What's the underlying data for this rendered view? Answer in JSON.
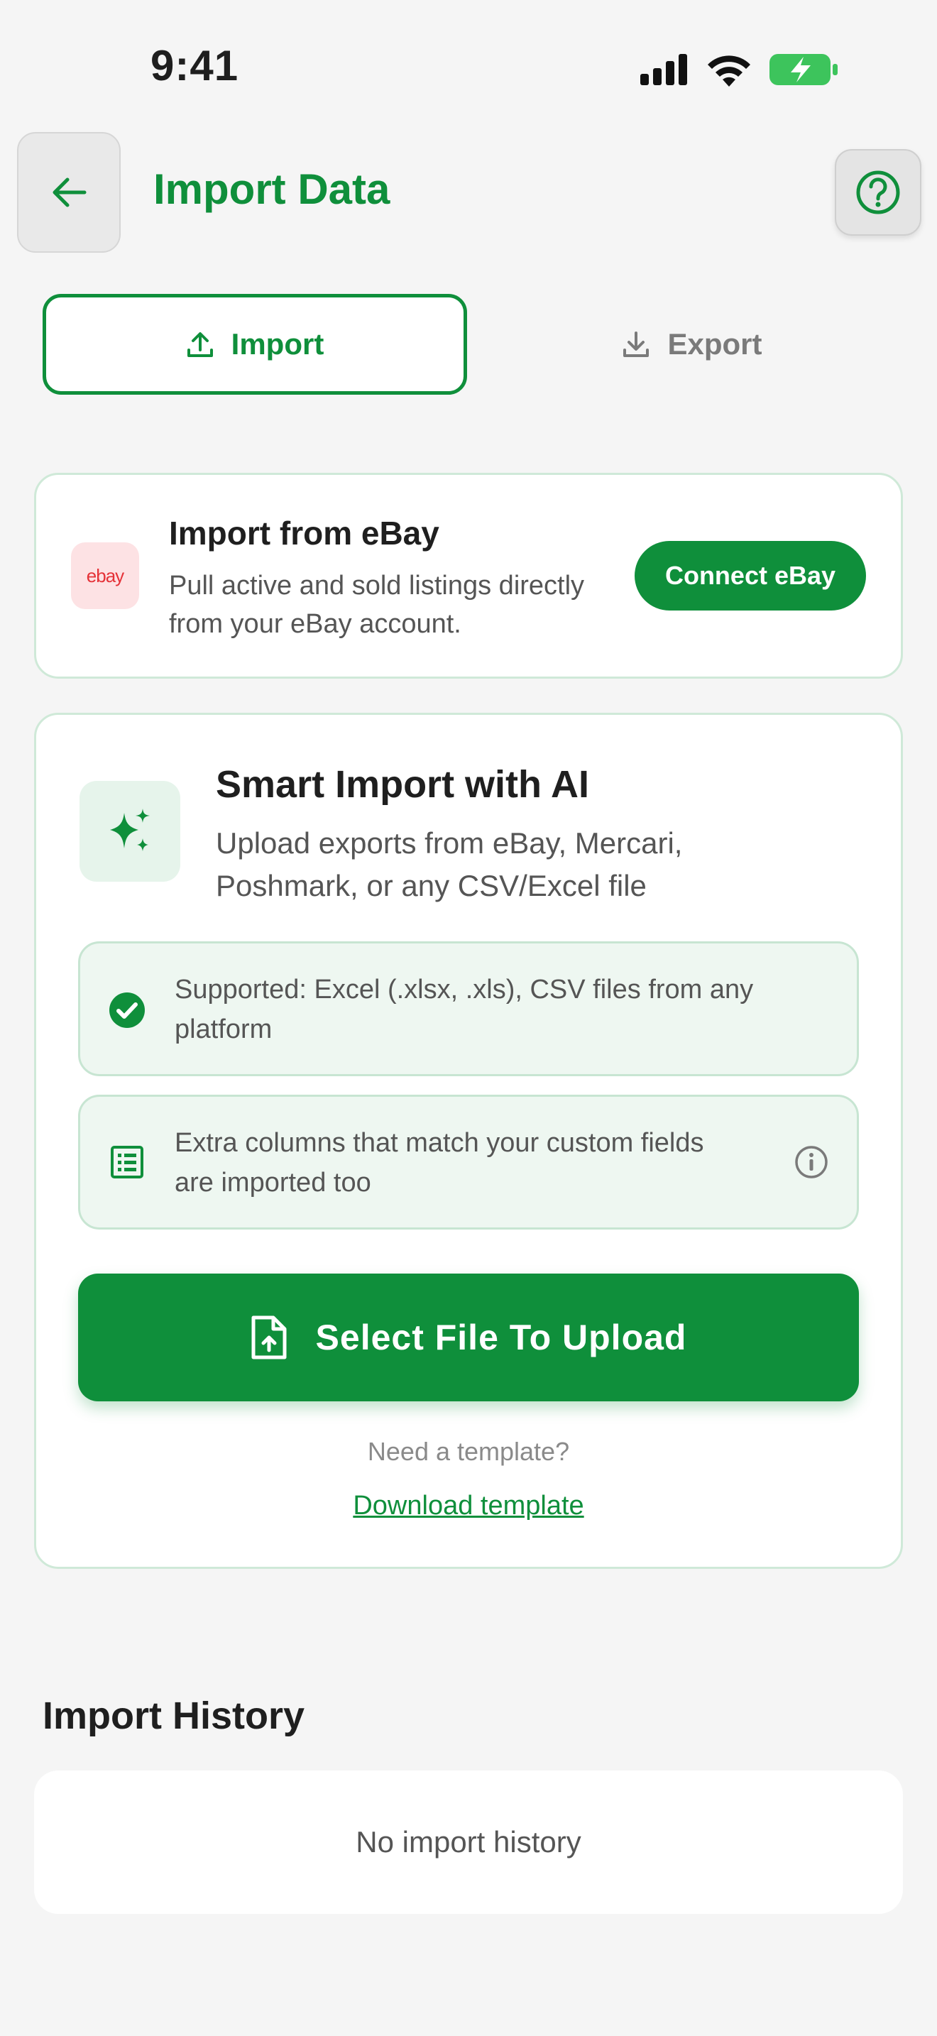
{
  "status_bar": {
    "time": "9:41",
    "icons": [
      "cellular-signal-icon",
      "wifi-icon",
      "battery-charging-icon"
    ]
  },
  "header": {
    "title": "Import Data",
    "back_icon": "arrow-left-icon",
    "help_icon": "help-circle-icon"
  },
  "tabs": [
    {
      "label": "Import",
      "icon": "upload-icon",
      "selected": true
    },
    {
      "label": "Export",
      "icon": "download-icon",
      "selected": false
    }
  ],
  "ebay_card": {
    "logo_text": "ebay",
    "title": "Import from eBay",
    "description": "Pull active and sold listings directly from your eBay account.",
    "button_label": "Connect eBay"
  },
  "smart_import": {
    "icon": "sparkles-icon",
    "title": "Smart Import with AI",
    "description": "Upload exports from eBay, Mercari, Poshmark, or any CSV/Excel file",
    "info_items": [
      {
        "icon": "check-circle-icon",
        "text": "Supported: Excel (.xlsx, .xls), CSV files from any platform"
      },
      {
        "icon": "list-icon",
        "text": "Extra columns that match your custom fields are imported too",
        "trailing_icon": "info-icon"
      }
    ],
    "upload_button_label": "Select File To Upload",
    "upload_button_icon": "file-upload-icon",
    "template_prompt": "Need a template?",
    "template_link": "Download template"
  },
  "history": {
    "title": "Import History",
    "empty_text": "No import history"
  },
  "colors": {
    "accent": "#0f8f3b",
    "background": "#f5f5f5",
    "card_border": "#cfe9d8",
    "info_bg": "#eef7f1"
  }
}
